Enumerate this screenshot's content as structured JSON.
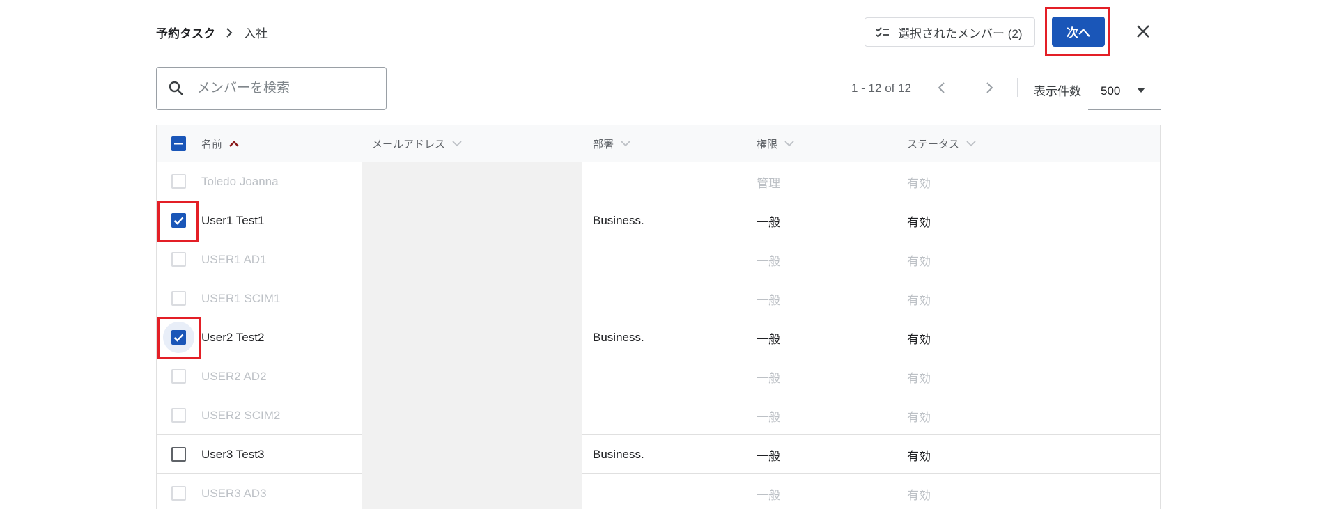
{
  "header": {
    "breadcrumb_parent": "予約タスク",
    "breadcrumb_current": "入社",
    "selected_members_label": "選択されたメンバー (2)",
    "next_label": "次へ"
  },
  "search": {
    "placeholder": "メンバーを検索"
  },
  "pagination": {
    "range": "1 - 12 of 12",
    "per_page_label": "表示件数",
    "per_page_value": "500"
  },
  "table": {
    "columns": [
      "名前",
      "メールアドレス",
      "部署",
      "権限",
      "ステータス"
    ],
    "rows": [
      {
        "name": "Toledo Joanna",
        "department": "",
        "role": "管理",
        "status": "有効",
        "checked": false,
        "enabled": false
      },
      {
        "name": "User1 Test1",
        "department": "Business.",
        "role": "一般",
        "status": "有効",
        "checked": true,
        "enabled": true
      },
      {
        "name": "USER1 AD1",
        "department": "",
        "role": "一般",
        "status": "有効",
        "checked": false,
        "enabled": false
      },
      {
        "name": "USER1 SCIM1",
        "department": "",
        "role": "一般",
        "status": "有効",
        "checked": false,
        "enabled": false
      },
      {
        "name": "User2 Test2",
        "department": "Business.",
        "role": "一般",
        "status": "有効",
        "checked": true,
        "enabled": true
      },
      {
        "name": "USER2 AD2",
        "department": "",
        "role": "一般",
        "status": "有効",
        "checked": false,
        "enabled": false
      },
      {
        "name": "USER2 SCIM2",
        "department": "",
        "role": "一般",
        "status": "有効",
        "checked": false,
        "enabled": false
      },
      {
        "name": "User3 Test3",
        "department": "Business.",
        "role": "一般",
        "status": "有効",
        "checked": false,
        "enabled": true
      },
      {
        "name": "USER3 AD3",
        "department": "",
        "role": "一般",
        "status": "有効",
        "checked": false,
        "enabled": false
      }
    ]
  },
  "colors": {
    "primary": "#1a56b8",
    "highlight": "#e31f26",
    "sort_arrow": "#8b1a1a",
    "disabled_text": "#bdc1c6"
  },
  "icons": {
    "breadcrumb_separator": "chevron-right-icon",
    "selected_members": "checklist-icon",
    "close": "close-icon",
    "search": "search-icon",
    "pager_prev": "chevron-left-icon",
    "pager_next": "chevron-right-icon",
    "per_page_dropdown": "caret-down-icon",
    "sort_active": "chevron-up-icon",
    "sort_inactive": "chevron-down-icon"
  }
}
